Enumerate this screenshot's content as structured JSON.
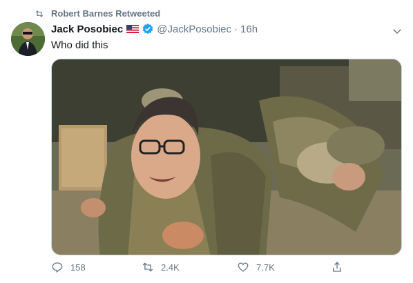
{
  "retweet": {
    "label": "Robert Barnes Retweeted"
  },
  "author": {
    "name": "Jack Posobiec",
    "handle": "@JackPosobiec",
    "separator": "·",
    "time": "16h"
  },
  "tweet": {
    "text": "Who did this"
  },
  "media": {
    "type": "photo"
  },
  "actions": {
    "replies": "158",
    "retweets": "2.4K",
    "likes": "7.7K"
  },
  "icons": {
    "retweet": "retweet-icon",
    "flag": "us-flag-icon",
    "verified": "verified-badge-icon",
    "more": "chevron-down-icon",
    "reply": "reply-icon",
    "like": "heart-icon",
    "share": "share-icon"
  },
  "colors": {
    "secondary_text": "#657786",
    "verified_blue": "#1da1f2",
    "text": "#14171a"
  }
}
